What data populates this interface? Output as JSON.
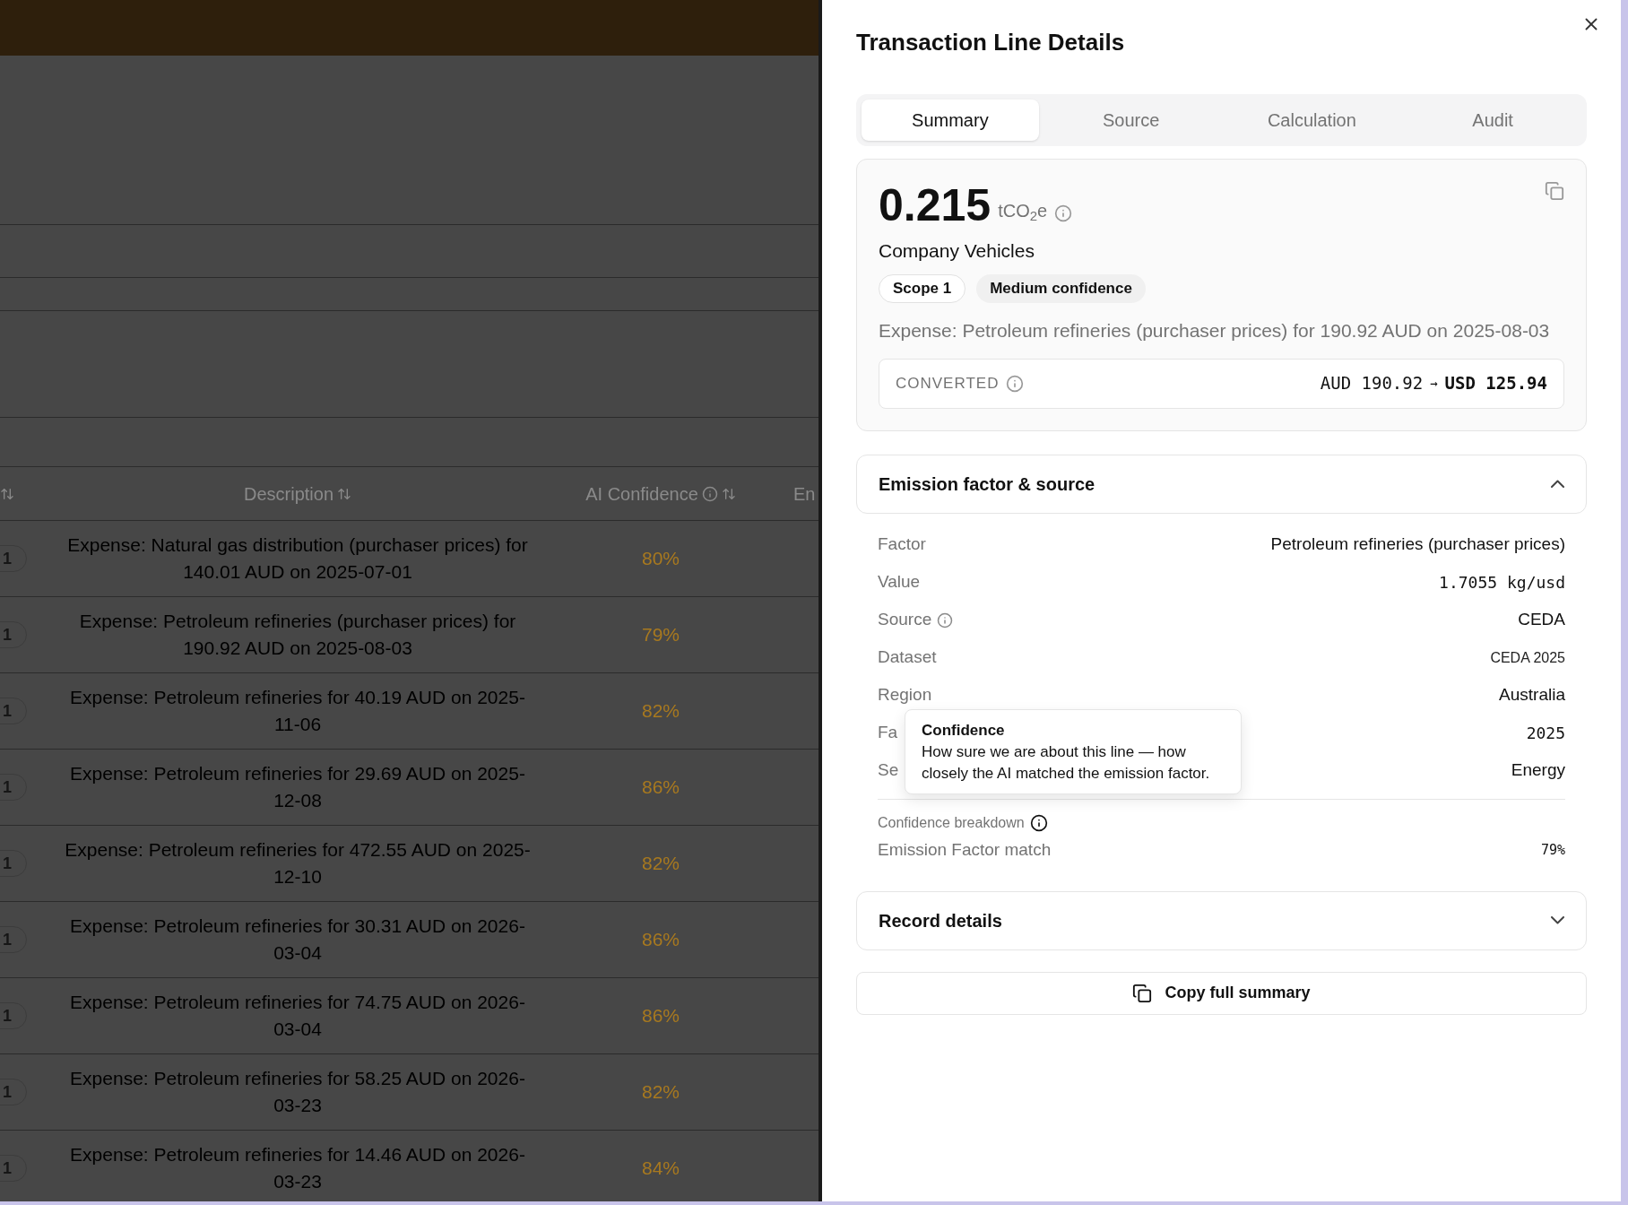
{
  "background": {
    "table": {
      "columns": [
        {
          "sortable": true,
          "info": false
        },
        {
          "label": "Description",
          "sortable": true,
          "info": false
        },
        {
          "label": "AI Confidence",
          "sortable": true,
          "info": true
        },
        {
          "label": "En",
          "sortable": false,
          "info": false
        }
      ],
      "rows": [
        {
          "scope": "1",
          "description": "Expense: Natural gas distribution (purchaser prices) for 140.01 AUD on 2025-07-01",
          "confidence": "80%"
        },
        {
          "scope": "1",
          "description": "Expense: Petroleum refineries (purchaser prices) for 190.92 AUD on 2025-08-03",
          "confidence": "79%"
        },
        {
          "scope": "1",
          "description": "Expense: Petroleum refineries for 40.19 AUD on 2025-11-06",
          "confidence": "82%"
        },
        {
          "scope": "1",
          "description": "Expense: Petroleum refineries for 29.69 AUD on 2025-12-08",
          "confidence": "86%"
        },
        {
          "scope": "1",
          "description": "Expense: Petroleum refineries for 472.55 AUD on 2025-12-10",
          "confidence": "82%"
        },
        {
          "scope": "1",
          "description": "Expense: Petroleum refineries for 30.31 AUD on 2026-03-04",
          "confidence": "86%"
        },
        {
          "scope": "1",
          "description": "Expense: Petroleum refineries for 74.75 AUD on 2026-03-04",
          "confidence": "86%"
        },
        {
          "scope": "1",
          "description": "Expense: Petroleum refineries for 58.25 AUD on 2026-03-23",
          "confidence": "82%"
        },
        {
          "scope": "1",
          "description": "Expense: Petroleum refineries for 14.46 AUD on 2026-03-23",
          "confidence": "84%"
        }
      ]
    }
  },
  "panel": {
    "title": "Transaction Line Details",
    "tabs": [
      {
        "label": "Summary",
        "selected": true
      },
      {
        "label": "Source",
        "selected": false
      },
      {
        "label": "Calculation",
        "selected": false
      },
      {
        "label": "Audit",
        "selected": false
      }
    ],
    "summary": {
      "amount": "0.215",
      "unit": "tCO$_{2}$e",
      "category": "Company Vehicles",
      "badges": [
        {
          "label": "Scope 1",
          "kind": "outline"
        },
        {
          "label": "Medium confidence",
          "kind": "filled"
        }
      ],
      "description": "Expense: Petroleum refineries (purchaser prices) for 190.92 AUD on 2025-08-03",
      "converted": {
        "label": "CONVERTED",
        "from": "AUD 190.92",
        "arrow": "→",
        "to": "USD 125.94"
      }
    },
    "sections": [
      {
        "title": "Emission factor & source",
        "expanded": true,
        "rows": [
          {
            "label": "Factor",
            "value": "Petroleum refineries (purchaser prices)",
            "kind": "plain",
            "info": false
          },
          {
            "label": "Value",
            "value": "1.7055 kg/usd",
            "kind": "mono",
            "info": false
          },
          {
            "label": "Source",
            "value": "CEDA",
            "kind": "plain",
            "info": true
          },
          {
            "label": "Dataset",
            "value": "CEDA 2025",
            "kind": "small",
            "info": false
          },
          {
            "label": "Region",
            "value": "Australia",
            "kind": "plain",
            "info": false
          },
          {
            "label": "Fa",
            "value": "2025",
            "kind": "mono",
            "info": false
          },
          {
            "label": "Se",
            "value": "Energy",
            "kind": "plain",
            "info": false
          }
        ],
        "breakdown": {
          "title": "Confidence breakdown",
          "items": [
            {
              "label": "Emission Factor match",
              "value": "79%"
            }
          ]
        }
      },
      {
        "title": "Record details",
        "expanded": false
      }
    ],
    "copy_button": "Copy full summary",
    "tooltip": {
      "title": "Confidence",
      "text": "How sure we are about this line — how closely the AI matched the emission factor."
    }
  }
}
